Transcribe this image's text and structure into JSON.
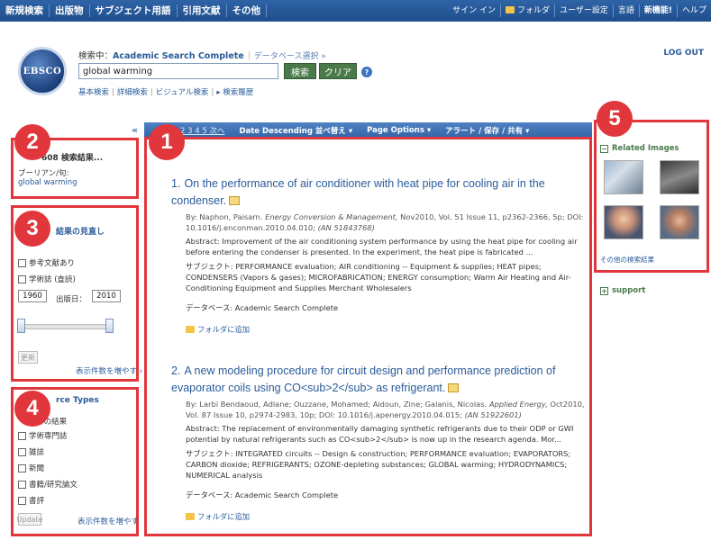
{
  "topnav": {
    "left": [
      "新規検索",
      "出版物",
      "サブジェクト用語",
      "引用文献",
      "その他"
    ],
    "right": [
      "サイン イン",
      "フォルダ",
      "ユーザー設定",
      "言語",
      "新機能!",
      "ヘルプ"
    ]
  },
  "header": {
    "logo_text": "EBSCO",
    "searching_prefix": "検索中：",
    "database": "Academic Search Complete",
    "choose_db": "データベース選択 »",
    "query": "global warming",
    "search_btn": "検索",
    "clear_btn": "クリア",
    "help": "?",
    "sublinks": [
      "基本検索",
      "詳細検索",
      "ビジュアル検索",
      "▸ 検索履歴"
    ],
    "logout": "LOG OUT"
  },
  "resultbar": {
    "collapse": "«",
    "pages": "2  3  4  5  次へ",
    "sort": "Date Descending 並べ替え ▾",
    "page_options": "Page Options ▾",
    "alert": "アラート / 保存 / 共有 ▾"
  },
  "panel2": {
    "badge": "2",
    "title": "608 検索結果...",
    "label": "ブーリアン/句:",
    "value": "global warming"
  },
  "panel3": {
    "badge": "3",
    "title": "結果の見直し",
    "checks": [
      "参考文献あり",
      "学術誌 (査読)"
    ],
    "year_from": "1960",
    "year_to": "2010",
    "date_label": "出版日：",
    "update": "更新",
    "more": "表示件数を増やす ›"
  },
  "panel4": {
    "badge": "4",
    "title": "rce Types",
    "checks": [
      "べての結果",
      "学術専門誌",
      "雑誌",
      "新聞",
      "書籍/研究論文",
      "書評"
    ],
    "update": "Update",
    "more": "表示件数を増やす"
  },
  "badge1": "1",
  "badge5": "5",
  "results": [
    {
      "num": "1.",
      "title": "On the performance of air conditioner with heat pipe for cooling air in the condenser.",
      "meta_authors": "By: Naphon, Paisarn. ",
      "meta_journal": "Energy Conversion & Management,",
      "meta_rest": " Nov2010, Vol. 51 Issue 11, p2362-2366, 5p; DOI: 10.1016/j.enconman.2010.04.010; ",
      "meta_an": "(AN 51843768)",
      "abstract": "Abstract: Improvement of the air conditioning system performance by using the heat pipe for cooling air before entering the condenser is presented. In the experiment, the heat pipe is fabricated ...",
      "subjects": "サブジェクト: PERFORMANCE evaluation; AIR conditioning -- Equipment & supplies; HEAT pipes; CONDENSERS (Vapors & gases); MICROFABRICATION; ENERGY consumption; Warm Air Heating and Air-Conditioning Equipment and Supplies Merchant Wholesalers",
      "database": "データベース: Academic Search Complete",
      "folder": "フォルダに追加"
    },
    {
      "num": "2.",
      "title": "A new modeling procedure for circuit design and performance prediction of evaporator coils using CO<sub>2</sub> as refrigerant.",
      "meta_authors": "By: Larbi Bendaoud, Adlane; Ouzzane, Mohamed; Aidoun, Zine; Galanis, Nicolas. ",
      "meta_journal": "Applied Energy,",
      "meta_rest": " Oct2010, Vol. 87 Issue 10, p2974-2983, 10p; DOI: 10.1016/j.apenergy.2010.04.015; ",
      "meta_an": "(AN 51922601)",
      "abstract": "Abstract: The replacement of environmentally damaging synthetic refrigerants due to their ODP or GWI potential by natural refrigerants such as CO<sub>2</sub> is now up in the research agenda. Mor...",
      "subjects": "サブジェクト: INTEGRATED circuits -- Design & construction; PERFORMANCE evaluation; EVAPORATORS; CARBON dioxide; REFRIGERANTS; OZONE-depleting substances; GLOBAL warming; HYDRODYNAMICS; NUMERICAL analysis",
      "database": "データベース: Academic Search Complete",
      "folder": "フォルダに追加"
    }
  ],
  "right": {
    "title": "Related Images",
    "more": "その他の検索結果",
    "support": "support"
  }
}
